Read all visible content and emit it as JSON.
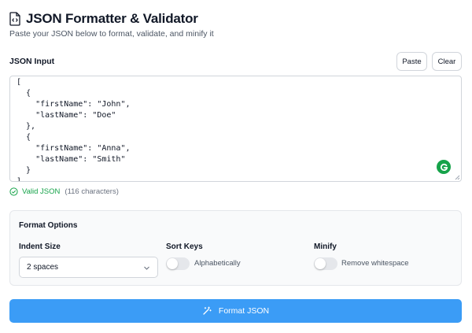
{
  "header": {
    "title": "JSON Formatter & Validator",
    "subtitle": "Paste your JSON below to format, validate, and minify it",
    "icon": "json-file-icon"
  },
  "input": {
    "label": "JSON Input",
    "paste_label": "Paste",
    "clear_label": "Clear",
    "value": "[\n  {\n    \"firstName\": \"John\",\n    \"lastName\": \"Doe\"\n  },\n  {\n    \"firstName\": \"Anna\",\n    \"lastName\": \"Smith\"\n  }\n]"
  },
  "status": {
    "valid_label": "Valid JSON",
    "char_count": "(116 characters)"
  },
  "options": {
    "title": "Format Options",
    "indent": {
      "label": "Indent Size",
      "selected": "2 spaces"
    },
    "sort_keys": {
      "label": "Sort Keys",
      "toggle_text": "Alphabetically",
      "enabled": false
    },
    "minify": {
      "label": "Minify",
      "toggle_text": "Remove whitespace",
      "enabled": false
    }
  },
  "actions": {
    "format_label": "Format JSON"
  },
  "colors": {
    "primary": "#3b9cf6",
    "valid": "#16a34a",
    "grammarly": "#16a34a"
  }
}
